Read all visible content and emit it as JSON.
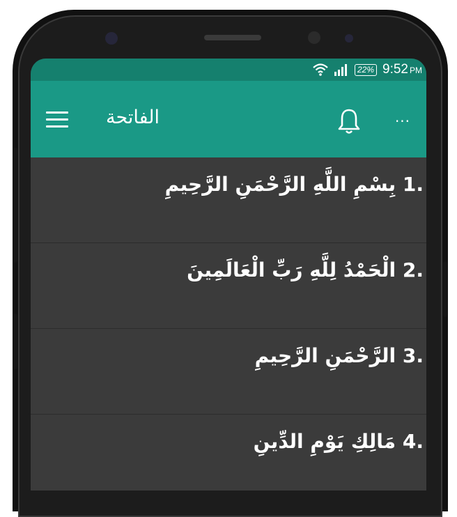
{
  "status_bar": {
    "time": "9:52",
    "period": "PM",
    "battery": "22%",
    "icons": [
      "wifi-icon",
      "signal-icon",
      "battery-icon"
    ]
  },
  "toolbar": {
    "title": "الفاتحة",
    "icons": [
      "menu-icon",
      "bell-icon",
      "more-icon"
    ],
    "more_label": "···"
  },
  "verses": [
    {
      "text": ".1 بِسْمِ اللَّهِ الرَّحْمَنِ الرَّحِيمِ"
    },
    {
      "text": ".2 الْحَمْدُ لِلَّهِ رَبِّ الْعَالَمِينَ"
    },
    {
      "text": ".3 الرَّحْمَنِ الرَّحِيمِ"
    },
    {
      "text": ".4 مَالِكِ يَوْمِ الدِّينِ"
    }
  ],
  "colors": {
    "status_bar": "#15806e",
    "toolbar": "#1a9986",
    "list_bg": "#3b3b3b",
    "divider": "#2c2c2c",
    "text": "#ffffff"
  }
}
